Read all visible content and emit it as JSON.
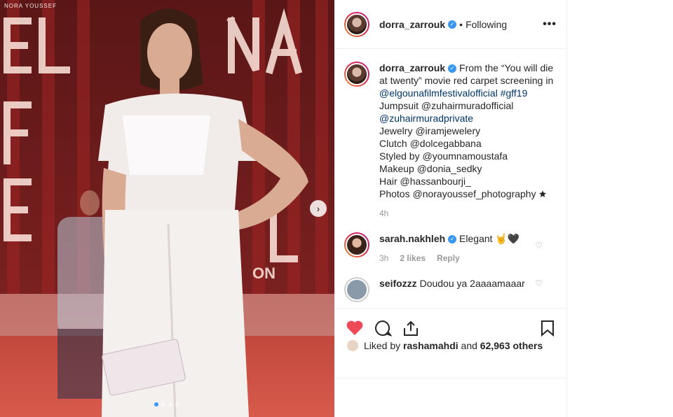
{
  "photo": {
    "watermark": "NORA YOUSSEF",
    "sign_text": "ELGOUNA FILM FESTIVAL",
    "sign_sub": "ON"
  },
  "post": {
    "author": "dorra_zarrouk",
    "separator": "•",
    "follow_state": "Following",
    "more_label": "•••"
  },
  "caption": {
    "author": "dorra_zarrouk",
    "lines": [
      "From the “You will die at twenty” movie red carpet screening in",
      "@elgounafilmfestivalofficial #gff19",
      "Jumpsuit @zuhairmuradofficial",
      "@zuhairmuradprivate",
      "Jewelry @iramjewelery",
      "Clutch @dolcegabbana",
      "Styled by @youmnamoustafa",
      "Makeup @donia_sedky",
      "Hair @hassanbourji_",
      "Photos @norayoussef_photography 🟊"
    ],
    "time": "4h"
  },
  "comments": [
    {
      "author": "sarah.nakhleh",
      "text": "Elegant 🤘🖤",
      "time": "3h",
      "likes": "2 likes",
      "reply": "Reply"
    },
    {
      "author": "seifozzz",
      "text": "Doudou ya 2aaaamaaar",
      "time": "",
      "likes": "",
      "reply": ""
    }
  ],
  "likes_line": {
    "prefix": "Liked by",
    "user": "rashamahdi",
    "middle": "and",
    "others": "62,963 others"
  },
  "colors": {
    "like_heart": "#ed4956",
    "link": "#003569",
    "verified": "#3897f0"
  }
}
